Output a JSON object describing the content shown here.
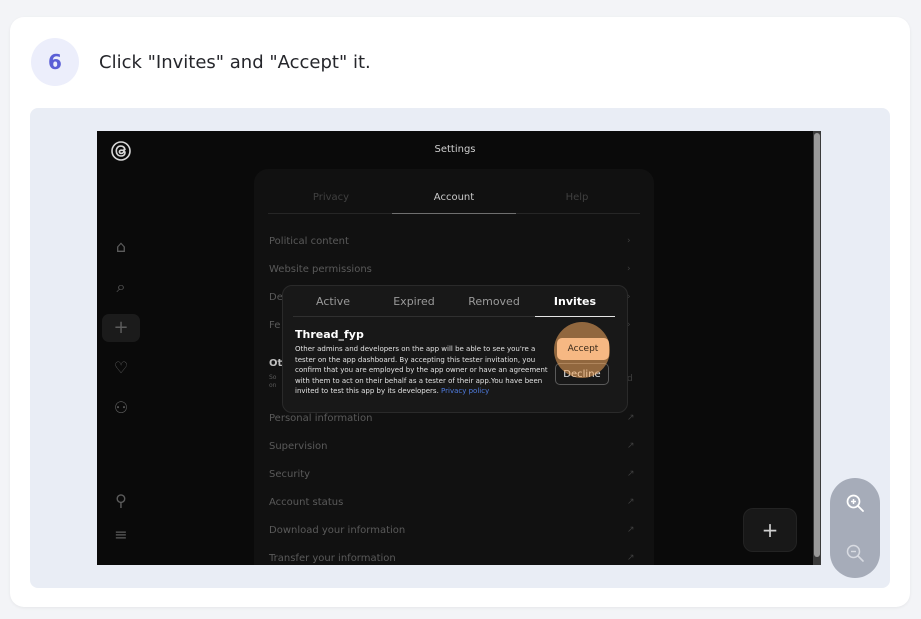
{
  "step": {
    "number": "6",
    "instruction": "Click \"Invites\" and \"Accept\" it."
  },
  "screen": {
    "header_title": "Settings",
    "tabs": [
      "Privacy",
      "Account",
      "Help"
    ],
    "rows": [
      "Political content",
      "Website permissions",
      "De",
      "Fe",
      "Ot",
      "Personal information",
      "Supervision",
      "Security",
      "Account status",
      "Download your information",
      "Transfer your information"
    ],
    "row_sub_left": "So",
    "row_sub_left2": "on",
    "row_sub_right": "d",
    "modal": {
      "tabs": [
        "Active",
        "Expired",
        "Removed",
        "Invites"
      ],
      "app_name": "Thread_fyp",
      "description": "Other admins and developers on the app will be able to see you're a tester on the app dashboard. By accepting this tester invitation, you confirm that you are employed by the app owner or have an agreement with them to act on their behalf as a tester of their app.You have been invited to test this app by its developers.",
      "privacy_link": "Privacy policy",
      "accept_label": "Accept",
      "decline_label": "Decline"
    },
    "fab_label": "+"
  },
  "colors": {
    "accent": "#5b5fd6",
    "accept": "#f6b883",
    "highlight": "#f6aa5f"
  }
}
